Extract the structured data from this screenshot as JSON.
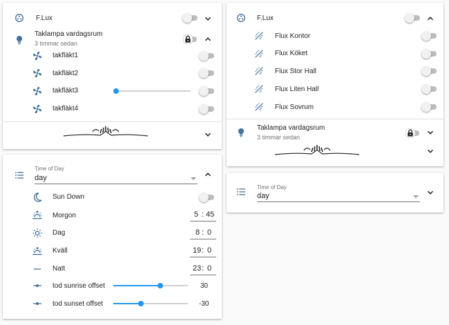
{
  "colors": {
    "icon": "#44739e",
    "accent": "#2196f3",
    "toggle_off_track": "#bdbdbd"
  },
  "left_card": {
    "flux": {
      "label": "F.Lux",
      "icon": "flux-icon"
    },
    "lamp": {
      "label": "Taklampa vardagsrum",
      "sub": "3 timmar sedan",
      "icon": "lightbulb-icon"
    },
    "fans": [
      {
        "label": "takfläkt1",
        "icon": "fan-icon",
        "has_slider": false
      },
      {
        "label": "takfläkt2",
        "icon": "fan-icon",
        "has_slider": false
      },
      {
        "label": "takfläkt3",
        "icon": "fan-icon",
        "has_slider": true,
        "slider_value": 0
      },
      {
        "label": "takfläkt4",
        "icon": "fan-icon",
        "has_slider": false
      }
    ]
  },
  "tod_card": {
    "select_label": "Time of Day",
    "select_value": "day",
    "sun_down": {
      "label": "Sun Down"
    },
    "times": [
      {
        "label": "Morgon",
        "icon": "weather-sunset-up-icon",
        "h": "5",
        "m": "45"
      },
      {
        "label": "Dag",
        "icon": "sun-icon",
        "h": "8",
        "m": "0"
      },
      {
        "label": "Kväll",
        "icon": "weather-sunset-down-icon",
        "h": "19",
        "m": "0"
      },
      {
        "label": "Natt",
        "icon": "minus-icon",
        "h": "23",
        "m": "0"
      }
    ],
    "offsets": [
      {
        "label": "tod sunrise offset",
        "value": "30",
        "fraction": 0.63
      },
      {
        "label": "tod sunset offset",
        "value": "-30",
        "fraction": 0.37
      }
    ],
    "time_separator": ":"
  },
  "right_card": {
    "flux": {
      "label": "F.Lux"
    },
    "items": [
      {
        "label": "Flux Kontor",
        "icon": "flux-switch-icon"
      },
      {
        "label": "Flux Köket",
        "icon": "flux-switch-icon"
      },
      {
        "label": "Flux Stor Hall",
        "icon": "flux-switch-icon"
      },
      {
        "label": "Flux Liten Hall",
        "icon": "flux-switch-icon"
      },
      {
        "label": "Flux Sovrum",
        "icon": "flux-switch-icon"
      }
    ],
    "lamp": {
      "label": "Taklampa vardagsrum",
      "sub": "3 timmar sedan"
    }
  },
  "right_tod_card": {
    "select_label": "Time of Day",
    "select_value": "day"
  }
}
